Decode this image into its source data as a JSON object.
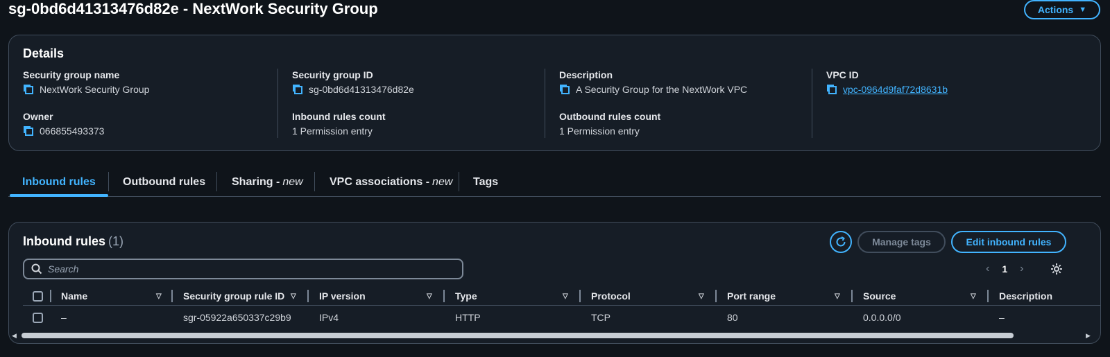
{
  "header": {
    "title": "sg-0bd6d41313476d82e - NextWork Security Group",
    "actions_label": "Actions"
  },
  "details": {
    "title": "Details",
    "fields": {
      "sg_name_label": "Security group name",
      "sg_name_value": "NextWork Security Group",
      "sg_id_label": "Security group ID",
      "sg_id_value": "sg-0bd6d41313476d82e",
      "description_label": "Description",
      "description_value": "A Security Group for the NextWork VPC",
      "vpc_label": "VPC ID",
      "vpc_value": "vpc-0964d9faf72d8631b",
      "owner_label": "Owner",
      "owner_value": "066855493373",
      "inbound_count_label": "Inbound rules count",
      "inbound_count_value": "1 Permission entry",
      "outbound_count_label": "Outbound rules count",
      "outbound_count_value": "1 Permission entry"
    }
  },
  "tabs": [
    {
      "label": "Inbound rules",
      "suffix": ""
    },
    {
      "label": "Outbound rules",
      "suffix": ""
    },
    {
      "label": "Sharing -",
      "suffix": "new"
    },
    {
      "label": "VPC associations -",
      "suffix": "new"
    },
    {
      "label": "Tags",
      "suffix": ""
    }
  ],
  "rules": {
    "title": "Inbound rules",
    "count": "(1)",
    "manage_tags_label": "Manage tags",
    "edit_label": "Edit inbound rules",
    "search_placeholder": "Search",
    "page_number": "1",
    "columns": [
      "Name",
      "Security group rule ID",
      "IP version",
      "Type",
      "Protocol",
      "Port range",
      "Source",
      "Description"
    ],
    "rows": [
      [
        "–",
        "sgr-05922a650337c29b9",
        "IPv4",
        "HTTP",
        "TCP",
        "80",
        "0.0.0.0/0",
        "–"
      ]
    ]
  },
  "colors": {
    "accent": "#42b4ff",
    "background": "#0f141a",
    "card": "#161d26",
    "border": "#414d5c"
  }
}
